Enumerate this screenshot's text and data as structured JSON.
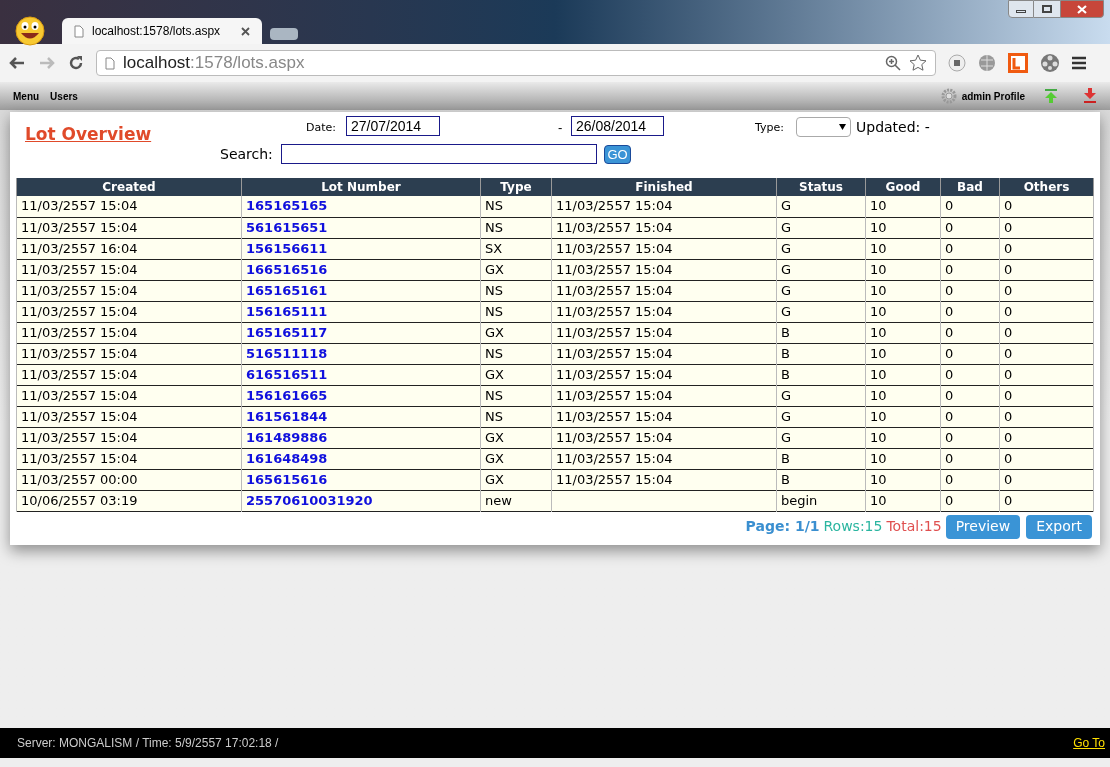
{
  "browser": {
    "tab_title": "localhost:1578/lots.aspx",
    "url_host": "localhost",
    "url_rest": ":1578/lots.aspx"
  },
  "menu_bar": {
    "items": [
      "Menu",
      "Users"
    ],
    "profile": "admin Profile"
  },
  "page": {
    "title": "Lot Overview",
    "date_label": "Date:",
    "date_from": "27/07/2014",
    "date_sep": "-",
    "date_to": "26/08/2014",
    "type_label": "Type:",
    "updated": "Updated: -",
    "search_label": "Search:",
    "go": "GO"
  },
  "table": {
    "columns": [
      "Created",
      "Lot Number",
      "Type",
      "Finished",
      "Status",
      "Good",
      "Bad",
      "Others"
    ],
    "rows": [
      [
        "11/03/2557 15:04",
        "165165165",
        "NS",
        "11/03/2557 15:04",
        "G",
        "10",
        "0",
        "0"
      ],
      [
        "11/03/2557 15:04",
        "561615651",
        "NS",
        "11/03/2557 15:04",
        "G",
        "10",
        "0",
        "0"
      ],
      [
        "11/03/2557 16:04",
        "156156611",
        "SX",
        "11/03/2557 15:04",
        "G",
        "10",
        "0",
        "0"
      ],
      [
        "11/03/2557 15:04",
        "166516516",
        "GX",
        "11/03/2557 15:04",
        "G",
        "10",
        "0",
        "0"
      ],
      [
        "11/03/2557 15:04",
        "165165161",
        "NS",
        "11/03/2557 15:04",
        "G",
        "10",
        "0",
        "0"
      ],
      [
        "11/03/2557 15:04",
        "156165111",
        "NS",
        "11/03/2557 15:04",
        "G",
        "10",
        "0",
        "0"
      ],
      [
        "11/03/2557 15:04",
        "165165117",
        "GX",
        "11/03/2557 15:04",
        "B",
        "10",
        "0",
        "0"
      ],
      [
        "11/03/2557 15:04",
        "516511118",
        "NS",
        "11/03/2557 15:04",
        "B",
        "10",
        "0",
        "0"
      ],
      [
        "11/03/2557 15:04",
        "616516511",
        "GX",
        "11/03/2557 15:04",
        "B",
        "10",
        "0",
        "0"
      ],
      [
        "11/03/2557 15:04",
        "156161665",
        "NS",
        "11/03/2557 15:04",
        "G",
        "10",
        "0",
        "0"
      ],
      [
        "11/03/2557 15:04",
        "161561844",
        "NS",
        "11/03/2557 15:04",
        "G",
        "10",
        "0",
        "0"
      ],
      [
        "11/03/2557 15:04",
        "161489886",
        "GX",
        "11/03/2557 15:04",
        "G",
        "10",
        "0",
        "0"
      ],
      [
        "11/03/2557 15:04",
        "161648498",
        "GX",
        "11/03/2557 15:04",
        "B",
        "10",
        "0",
        "0"
      ],
      [
        "11/03/2557 00:00",
        "165615616",
        "GX",
        "11/03/2557 15:04",
        "B",
        "10",
        "0",
        "0"
      ],
      [
        "10/06/2557 03:19",
        "25570610031920",
        "new",
        "",
        "begin",
        "10",
        "0",
        "0"
      ]
    ]
  },
  "pager": {
    "page": "Page: 1/1",
    "rows": "Rows:15",
    "total": "Total:15",
    "buttons": [
      "Preview",
      "Export"
    ]
  },
  "footer": {
    "text": "Server: MONGALISM / Time: 5/9/2557 17:02:18 /",
    "link": "Go To"
  }
}
